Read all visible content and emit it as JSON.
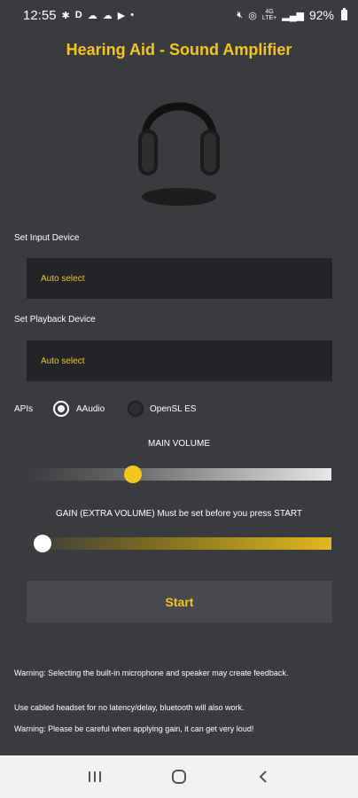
{
  "status": {
    "time": "12:55",
    "left_icons": [
      "settings-gear-icon",
      "d-app-icon",
      "cloud-icon",
      "cloud-icon",
      "play-icon",
      "dot-icon"
    ],
    "right_icons": [
      "mute-icon",
      "hotspot-icon",
      "4g-lte-icon",
      "signal-icon",
      "battery-icon"
    ],
    "network_top": "4G",
    "network_bottom": "LTE+",
    "battery": "92%"
  },
  "app": {
    "title": "Hearing Aid - Sound Amplifier",
    "accent": "#f5c518"
  },
  "input_device": {
    "label": "Set Input Device",
    "value": "Auto select"
  },
  "playback_device": {
    "label": "Set Playback Device",
    "value": "Auto select"
  },
  "apis": {
    "label": "APIs",
    "options": [
      {
        "label": "AAudio",
        "selected": true
      },
      {
        "label": "OpenSL ES",
        "selected": false
      }
    ]
  },
  "main_volume": {
    "label": "MAIN VOLUME",
    "level": 0.33
  },
  "gain": {
    "label": "GAIN (EXTRA VOLUME) Must be set before you press START",
    "level": 0.0
  },
  "start_button": {
    "label": "Start"
  },
  "notes": [
    "Warning: Selecting the built-in microphone and speaker may create feedback.",
    " Use cabled headset for no latency/delay, bluetooth will also work.",
    "Warning: Please be careful when applying gain, it can get very loud!"
  ],
  "nav": {
    "icons": [
      "recent-apps-icon",
      "home-icon",
      "back-icon"
    ]
  }
}
